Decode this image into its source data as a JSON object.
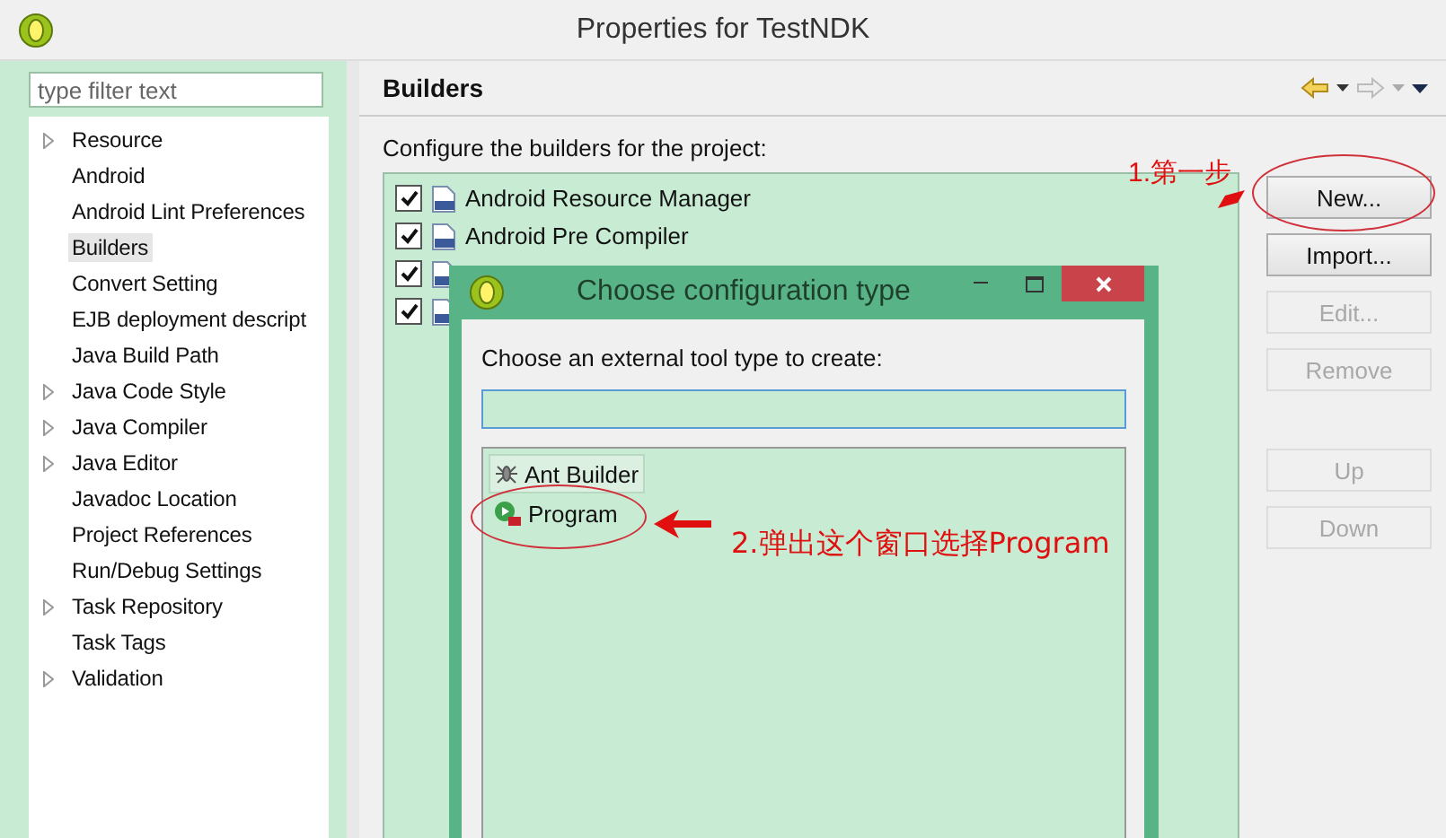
{
  "window": {
    "title": "Properties for TestNDK"
  },
  "sidebar": {
    "filter": {
      "placeholder": "type filter text"
    },
    "items": [
      {
        "label": "Resource",
        "expandable": true,
        "selected": false
      },
      {
        "label": "Android",
        "expandable": false,
        "selected": false
      },
      {
        "label": "Android Lint Preferences",
        "expandable": false,
        "selected": false
      },
      {
        "label": "Builders",
        "expandable": false,
        "selected": true
      },
      {
        "label": "Convert Setting",
        "expandable": false,
        "selected": false
      },
      {
        "label": "EJB deployment descript",
        "expandable": false,
        "selected": false
      },
      {
        "label": "Java Build Path",
        "expandable": false,
        "selected": false
      },
      {
        "label": "Java Code Style",
        "expandable": true,
        "selected": false
      },
      {
        "label": "Java Compiler",
        "expandable": true,
        "selected": false
      },
      {
        "label": "Java Editor",
        "expandable": true,
        "selected": false
      },
      {
        "label": "Javadoc Location",
        "expandable": false,
        "selected": false
      },
      {
        "label": "Project References",
        "expandable": false,
        "selected": false
      },
      {
        "label": "Run/Debug Settings",
        "expandable": false,
        "selected": false
      },
      {
        "label": "Task Repository",
        "expandable": true,
        "selected": false
      },
      {
        "label": "Task Tags",
        "expandable": false,
        "selected": false
      },
      {
        "label": "Validation",
        "expandable": true,
        "selected": false
      }
    ]
  },
  "page": {
    "title": "Builders",
    "caption": "Configure the builders for the project:",
    "builders": [
      {
        "label": "Android Resource Manager",
        "checked": true
      },
      {
        "label": "Android Pre Compiler",
        "checked": true
      },
      {
        "checked": true
      },
      {
        "checked": true
      }
    ],
    "buttons": [
      {
        "label": "New...",
        "disabled": false
      },
      {
        "label": "Import...",
        "disabled": false
      },
      {
        "label": "Edit...",
        "disabled": true
      },
      {
        "label": "Remove",
        "disabled": true
      }
    ],
    "move_buttons": [
      {
        "label": "Up",
        "disabled": true
      },
      {
        "label": "Down",
        "disabled": true
      }
    ]
  },
  "dialog": {
    "title": "Choose configuration type",
    "prompt": "Choose an external tool type to create:",
    "types": [
      {
        "label": "Ant Builder",
        "kind": "ant",
        "selected": true
      },
      {
        "label": "Program",
        "kind": "program",
        "selected": false
      }
    ]
  },
  "annotations": [
    {
      "kind": "new",
      "text": "1.第一步"
    },
    {
      "kind": "program",
      "text": "2.弹出这个窗口选择Program"
    }
  ]
}
